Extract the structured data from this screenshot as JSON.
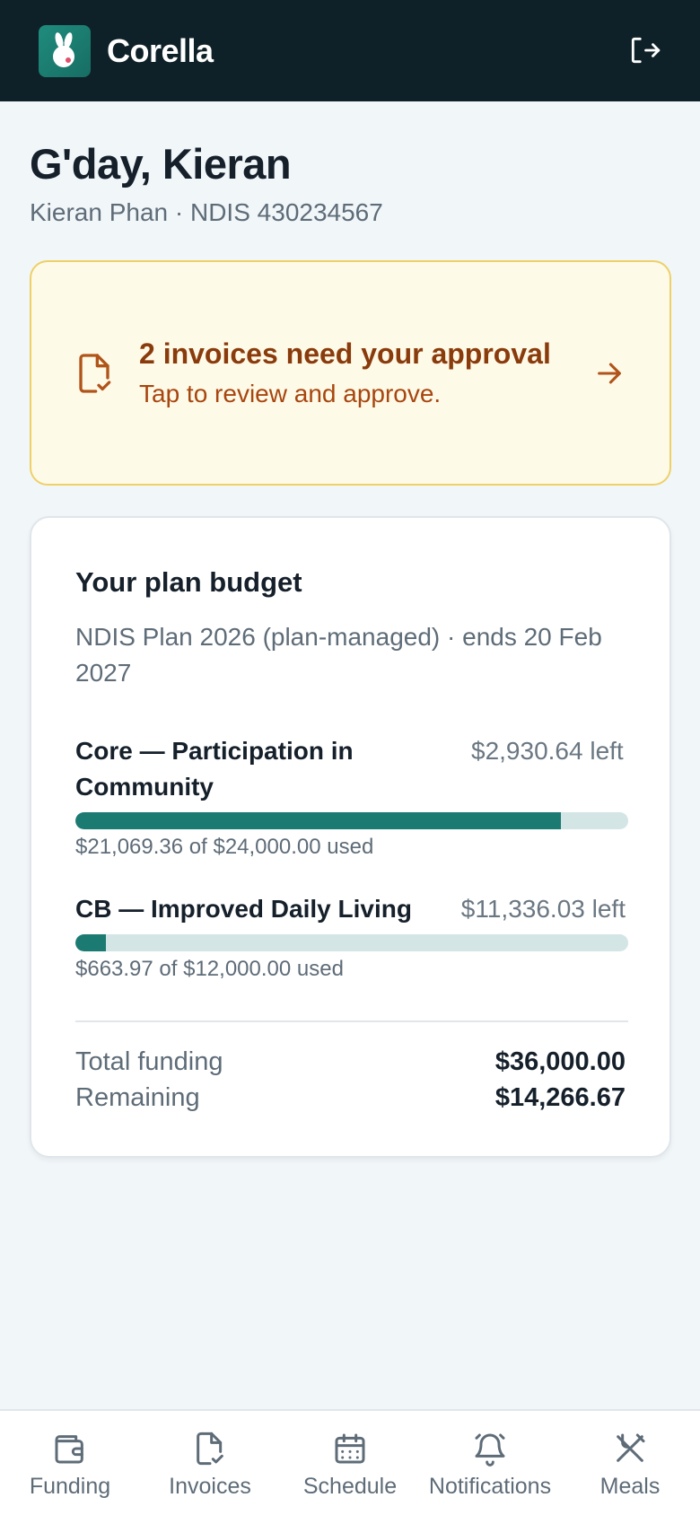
{
  "app": {
    "name": "Corella"
  },
  "header": {
    "logout_icon": "logout-icon"
  },
  "greeting": {
    "title": "G'day, Kieran",
    "subtitle": "Kieran Phan · NDIS 430234567"
  },
  "alert": {
    "title": "2 invoices need your approval",
    "subtitle": "Tap to review and approve.",
    "icon": "invoice-check-icon",
    "arrow_icon": "arrow-right-icon",
    "colors": {
      "background": "#fefae8",
      "border": "#eed067",
      "text": "#8a3b0c"
    }
  },
  "budget": {
    "title": "Your plan budget",
    "subtitle": "NDIS Plan 2026 (plan-managed) · ends 20 Feb 2027",
    "categories": [
      {
        "name": "Core — Participation in Community",
        "left": "$2,930.64 left",
        "used": "$21,069.36 of $24,000.00 used",
        "fraction_used": 0.8779
      },
      {
        "name": "CB — Improved Daily Living",
        "left": "$11,336.03 left",
        "used": "$663.97 of $12,000.00 used",
        "fraction_used": 0.0553
      }
    ],
    "totals": {
      "total_label": "Total funding",
      "total_value": "$36,000.00",
      "remaining_label": "Remaining",
      "remaining_value": "$14,266.67"
    },
    "colors": {
      "bar_fill": "#1b7a72",
      "bar_track": "#d3e5e4"
    }
  },
  "nav": {
    "items": [
      {
        "label": "Funding",
        "icon": "wallet-icon"
      },
      {
        "label": "Invoices",
        "icon": "invoice-check-icon"
      },
      {
        "label": "Schedule",
        "icon": "calendar-icon"
      },
      {
        "label": "Notifications",
        "icon": "bell-icon"
      },
      {
        "label": "Meals",
        "icon": "utensils-icon"
      }
    ]
  }
}
